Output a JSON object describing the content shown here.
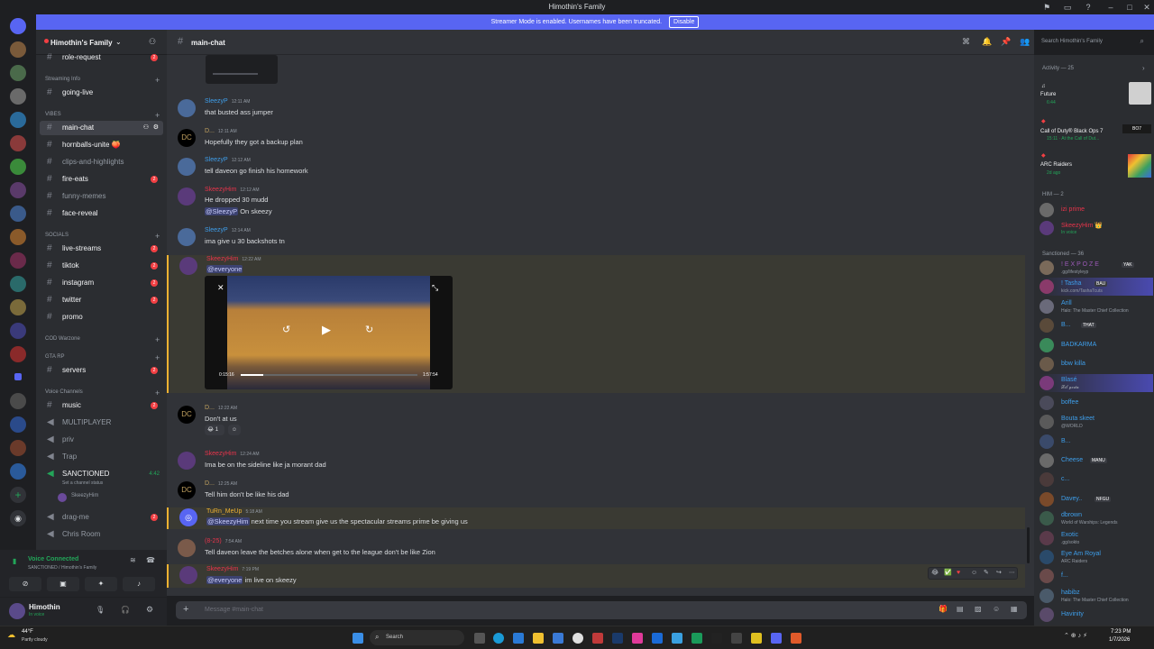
{
  "window": {
    "title": "Himothin's Family"
  },
  "banner": {
    "text": "Streamer Mode is enabled. Usernames have been truncated.",
    "button": "Disable"
  },
  "server": {
    "name": "Himothin's Family"
  },
  "sidebar": {
    "categories": {
      "streaming": "Streaming Info",
      "vibes": "VIBES",
      "socials": "SOCIALS",
      "cod": "COD Warzone",
      "gta": "GTA RP",
      "voice": "Voice Channels"
    },
    "channels": [
      {
        "label": "role-request",
        "badge": "2"
      },
      {
        "label": "going-live",
        "badge": ""
      },
      {
        "label": "main-chat",
        "badge": ""
      },
      {
        "label": "hornballs-unite 🍑",
        "badge": ""
      },
      {
        "label": "clips-and-highlights",
        "badge": ""
      },
      {
        "label": "fire-eats",
        "badge": "2"
      },
      {
        "label": "funny-memes",
        "badge": ""
      },
      {
        "label": "face-reveal",
        "badge": ""
      },
      {
        "label": "live-streams",
        "badge": "2"
      },
      {
        "label": "tiktok",
        "badge": "2"
      },
      {
        "label": "instagram",
        "badge": "2"
      },
      {
        "label": "twitter",
        "badge": "2"
      },
      {
        "label": "promo",
        "badge": ""
      },
      {
        "label": "servers",
        "badge": "2"
      },
      {
        "label": "music",
        "badge": "2"
      },
      {
        "label": "MULTIPLAYER",
        "badge": ""
      },
      {
        "label": "priv",
        "badge": ""
      },
      {
        "label": "Trap",
        "badge": ""
      },
      {
        "label": "SANCTIONED",
        "badge": ""
      },
      {
        "label": "drag-me",
        "badge": "2"
      },
      {
        "label": "Chris Room",
        "badge": ""
      }
    ],
    "sanctioned_sub": "Set a channel status",
    "sanctioned_time": "4:42",
    "sanctioned_user": "SkeezyHim"
  },
  "voice": {
    "status": "Voice Connected",
    "location": "SANCTIONED / Himothin's Family"
  },
  "user": {
    "name": "Himothin",
    "status": "In voice"
  },
  "chat": {
    "channel": "main-chat",
    "search_placeholder": "Search Himothin's Family",
    "composer_placeholder": "Message #main-chat",
    "messages": [
      {
        "user": "SleezyP",
        "time": "12:11 AM",
        "text": "that busted ass jumper",
        "color": "#3e9eea"
      },
      {
        "user": "D...",
        "time": "12:11 AM",
        "text": "Hopefully they got a backup plan",
        "color": "#c0a060"
      },
      {
        "user": "SleezyP",
        "time": "12:12 AM",
        "text": "tell daveon go finish his homework",
        "color": "#3e9eea"
      },
      {
        "user": "SkeezyHim",
        "time": "12:12 AM",
        "text": "He dropped 30 mudd",
        "text2_mention": "@SleezyP",
        "text2": " On skeezy",
        "color": "#e8344b"
      },
      {
        "user": "SleezyP",
        "time": "12:14 AM",
        "text": "ima give u 30 backshots tn",
        "color": "#3e9eea"
      },
      {
        "user": "SkeezyHim",
        "time": "12:22 AM",
        "mention": "@everyone",
        "color": "#e8344b"
      },
      {
        "user": "D...",
        "time": "12:22 AM",
        "text": "Don't at us",
        "reaction": "1",
        "color": "#c0a060"
      },
      {
        "user": "SkeezyHim",
        "time": "12:24 AM",
        "text": "Ima be on the sideline like ja morant dad",
        "color": "#e8344b"
      },
      {
        "user": "D...",
        "time": "12:25 AM",
        "text": "Tell him don't be like his dad",
        "color": "#c0a060"
      },
      {
        "user": "TuRn_MeUp",
        "time": "5:18 AM",
        "mention": "@SkeezyHim",
        "text": " next time you stream give us the spectacular streams prime be giving us",
        "color": "#f0b232"
      },
      {
        "user": "(8-25)",
        "time": "7:54 AM",
        "text": "Tell daveon leave the betches alone when get to the league don't be like Zion",
        "color": "#e8344b"
      },
      {
        "user": "SkeezyHim",
        "time": "7:19 PM",
        "mention": "@everyone",
        "text": " im live on skeezy",
        "color": "#e8344b"
      }
    ],
    "video": {
      "elapsed": "0:15:16",
      "duration": "1:57:54"
    }
  },
  "members": {
    "activity_header": "Activity — 25",
    "activities": [
      {
        "name": "Future",
        "detail": "6:44"
      },
      {
        "name": "Call of Duty® Black Ops 7",
        "detail": "15:11 · At the Call of Dut..."
      },
      {
        "name": "ARC Raiders",
        "detail": "2d ago"
      }
    ],
    "him_header": "HIM — 2",
    "him": [
      {
        "name": "izi prime",
        "status": ""
      },
      {
        "name": "SkeezyHim 👑",
        "status": "In voice"
      }
    ],
    "sanctioned_header": "Sanctioned — 36",
    "sanctioned": [
      {
        "name": "! E X P O Z E",
        "status": ".gg/lifestyleyp",
        "tag": "YAK"
      },
      {
        "name": "! Tasha",
        "status": "kick.com/TashaTcuts",
        "tag": "BAU"
      },
      {
        "name": "Arill",
        "status": "Halo: The Master Chief Collection"
      },
      {
        "name": "B...",
        "status": "",
        "tag": "THAT"
      },
      {
        "name": "BADKARMA",
        "status": ""
      },
      {
        "name": "bbw killa",
        "status": ""
      },
      {
        "name": "Blasé",
        "status": "𝓛𝓲𝓵 𝓰𝓸𝓭𝓪"
      },
      {
        "name": "boffee",
        "status": ""
      },
      {
        "name": "Bouta skeet",
        "status": "@WORLD"
      },
      {
        "name": "B...",
        "status": ""
      },
      {
        "name": "Cheese",
        "status": "",
        "tag": "MANU"
      },
      {
        "name": "c...",
        "status": ""
      },
      {
        "name": "Davey..",
        "status": "",
        "tag": "NFGU"
      },
      {
        "name": "dbrown",
        "status": "World of Warships: Legends"
      },
      {
        "name": "Exotic",
        "status": ".gg/sokto"
      },
      {
        "name": "Eye Am Royal",
        "status": "ARC Raiders"
      },
      {
        "name": "f...",
        "status": ""
      },
      {
        "name": "habibz",
        "status": "Halo: The Master Chief Collection"
      },
      {
        "name": "Havinity",
        "status": ""
      }
    ]
  },
  "taskbar": {
    "weather_temp": "44°F",
    "weather_desc": "Partly cloudy",
    "search": "Search",
    "time": "7:23 PM",
    "date": "1/7/2026"
  },
  "colors": {
    "accent": "#5865f2",
    "mention_highlight": "#f0b232",
    "badge": "#f23f43"
  }
}
